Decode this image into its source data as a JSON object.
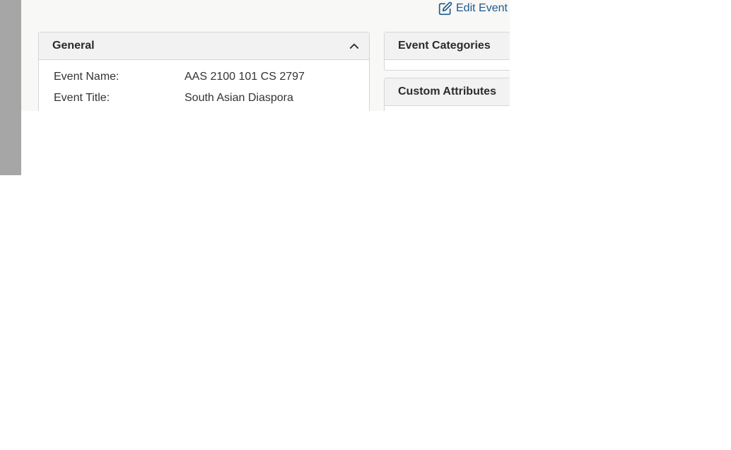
{
  "toolbar": {
    "edit_event_label": "Edit Event"
  },
  "general": {
    "title": "General",
    "fields": [
      {
        "label": "Event Name:",
        "value": "AAS 2100 101 CS 2797"
      },
      {
        "label": "Event Title:",
        "value": "South Asian Diaspora"
      }
    ]
  },
  "event_categories": {
    "title": "Event Categories"
  },
  "custom_attributes": {
    "title": "Custom Attributes"
  },
  "colors": {
    "link": "#1e5a8c",
    "rail": "#a6a6a6",
    "background": "#f8f8f7"
  }
}
